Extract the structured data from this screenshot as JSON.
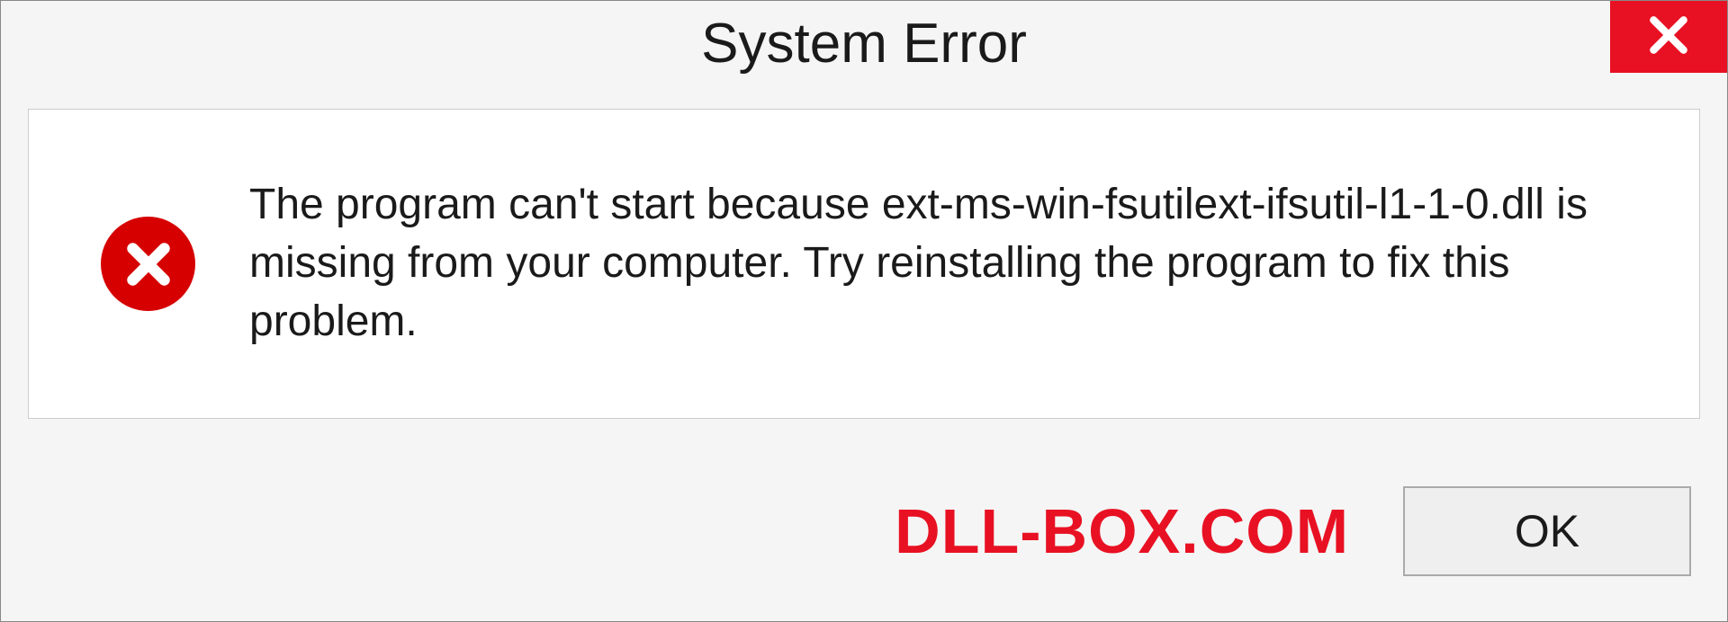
{
  "dialog": {
    "title": "System Error",
    "message": "The program can't start because ext-ms-win-fsutilext-ifsutil-l1-1-0.dll is missing from your computer. Try reinstalling the program to fix this problem.",
    "ok_label": "OK"
  },
  "watermark": "DLL-BOX.COM",
  "colors": {
    "close_bg": "#e81123",
    "error_icon_bg": "#d60000",
    "watermark_color": "#e81123"
  },
  "icons": {
    "close": "close-icon",
    "error": "error-icon"
  }
}
